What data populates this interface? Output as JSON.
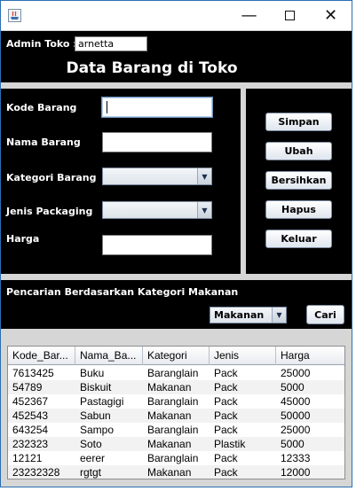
{
  "window": {
    "controls": {
      "minimize": "—",
      "maximize": "☐",
      "close": "✕"
    }
  },
  "header": {
    "admin_label": "Admin Toko :",
    "admin_value": "arnetta",
    "title": "Data Barang di Toko"
  },
  "form": {
    "kode_label": "Kode Barang",
    "kode_value": "",
    "nama_label": "Nama Barang",
    "nama_value": "",
    "kategori_label": "Kategori Barang",
    "kategori_value": "",
    "packaging_label": "Jenis Packaging",
    "packaging_value": "",
    "harga_label": "Harga",
    "harga_value": ""
  },
  "buttons": {
    "simpan": "Simpan",
    "ubah": "Ubah",
    "bersihkan": "Bersihkan",
    "hapus": "Hapus",
    "keluar": "Keluar"
  },
  "search": {
    "label": "Pencarian Berdasarkan Kategori Makanan",
    "selected": "Makanan",
    "button": "Cari"
  },
  "table": {
    "columns": [
      "Kode_Bar...",
      "Nama_Ba...",
      "Kategori",
      "Jenis",
      "Harga"
    ],
    "rows": [
      [
        "7613425",
        "Buku",
        "Baranglain",
        "Pack",
        "25000"
      ],
      [
        "54789",
        "Biskuit",
        "Makanan",
        "Pack",
        "5000"
      ],
      [
        "452367",
        "Pastagigi",
        "Baranglain",
        "Pack",
        "45000"
      ],
      [
        "452543",
        "Sabun",
        "Makanan",
        "Pack",
        "50000"
      ],
      [
        "643254",
        "Sampo",
        "Baranglain",
        "Pack",
        "25000"
      ],
      [
        "232323",
        "Soto",
        "Makanan",
        "Plastik",
        "5000"
      ],
      [
        "12121",
        "eerer",
        "Baranglain",
        "Pack",
        "12333"
      ],
      [
        "23232328",
        "rgtgt",
        "Makanan",
        "Pack",
        "12000"
      ]
    ]
  },
  "colors": {
    "panel_bg": "#000000",
    "window_bg": "#d6d6d6",
    "label_text": "#ffffff"
  }
}
